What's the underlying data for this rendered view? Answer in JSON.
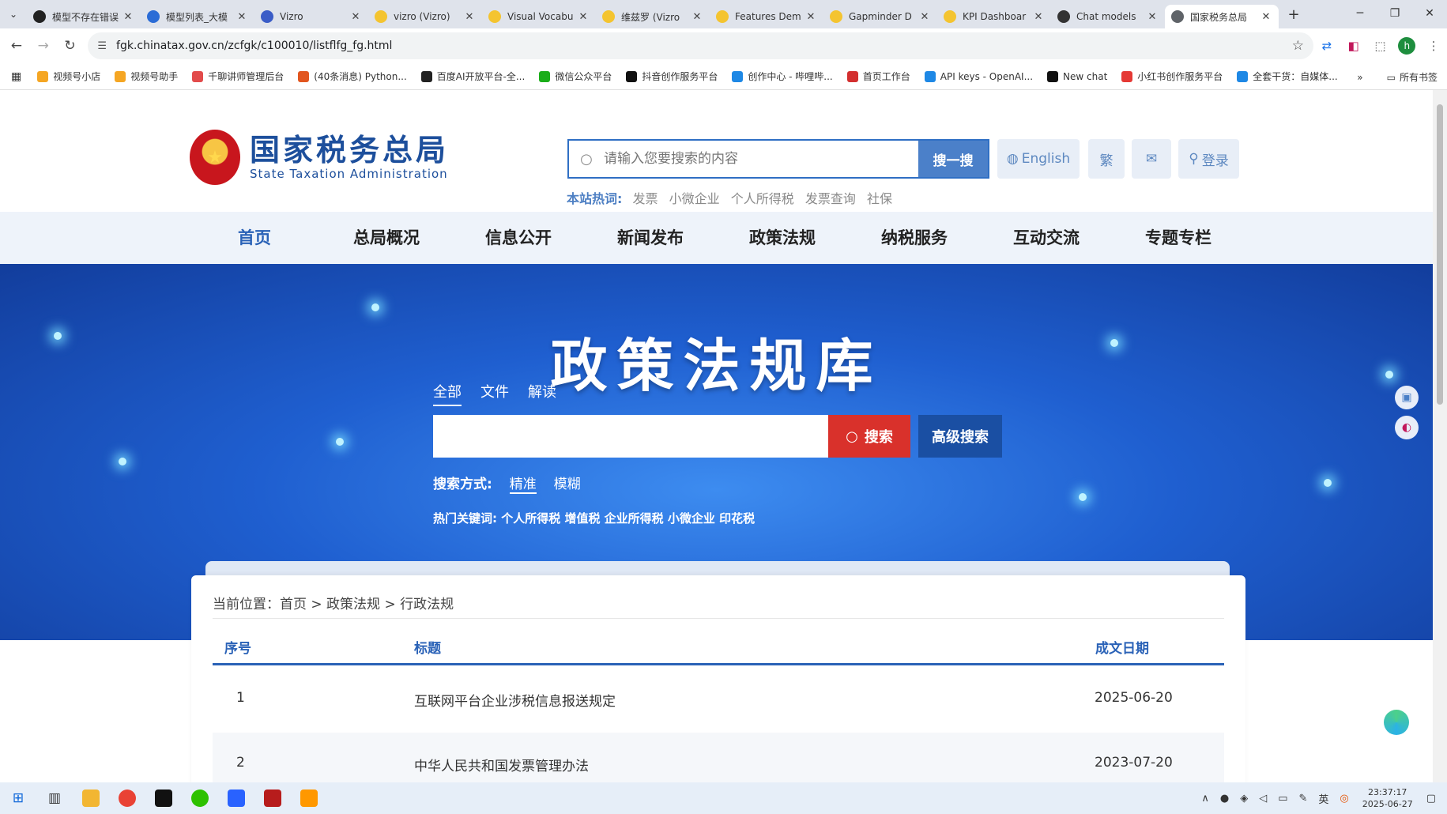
{
  "browser": {
    "tabs": [
      {
        "title": "模型不存在错误",
        "fav_color": "#222222",
        "active": false
      },
      {
        "title": "模型列表_大模",
        "fav_color": "#2b6cd6",
        "active": false
      },
      {
        "title": "Vizro",
        "fav_color": "#3a5cc7",
        "active": false
      },
      {
        "title": "vizro (Vizro)",
        "fav_color": "#f4c430",
        "active": false
      },
      {
        "title": "Visual Vocabu",
        "fav_color": "#f4c430",
        "active": false
      },
      {
        "title": "维兹罗 (Vizro",
        "fav_color": "#f4c430",
        "active": false
      },
      {
        "title": "Features Dem",
        "fav_color": "#f4c430",
        "active": false
      },
      {
        "title": "Gapminder D",
        "fav_color": "#f4c430",
        "active": false
      },
      {
        "title": "KPI Dashboar",
        "fav_color": "#f4c430",
        "active": false
      },
      {
        "title": "Chat models",
        "fav_color": "#333333",
        "active": false
      },
      {
        "title": "国家税务总局",
        "fav_color": "#5f6368",
        "active": true
      }
    ],
    "url": "fgk.chinatax.gov.cn/zcfgk/c100010/listflfg_fg.html",
    "profile_initial": "h",
    "bookmarks": [
      {
        "label": "视频号小店",
        "color": "#f5a623"
      },
      {
        "label": "视频号助手",
        "color": "#f5a623"
      },
      {
        "label": "千聊讲师管理后台",
        "color": "#e24b4b"
      },
      {
        "label": "(40条消息) Python...",
        "color": "#e2561f"
      },
      {
        "label": "百度AI开放平台-全...",
        "color": "#222222"
      },
      {
        "label": "微信公众平台",
        "color": "#1aad19"
      },
      {
        "label": "抖音创作服务平台",
        "color": "#111111"
      },
      {
        "label": "创作中心 - 哔哩哔...",
        "color": "#1e88e5"
      },
      {
        "label": "首页工作台",
        "color": "#d32f2f"
      },
      {
        "label": "API keys - OpenAI...",
        "color": "#1e88e5"
      },
      {
        "label": "New chat",
        "color": "#111111"
      },
      {
        "label": "小红书创作服务平台",
        "color": "#e53935"
      },
      {
        "label": "全套干货：自媒体...",
        "color": "#1e88e5"
      }
    ],
    "all_bookmarks_label": "所有书签"
  },
  "header": {
    "logo_cn": "国家税务总局",
    "logo_en": "State Taxation Administration",
    "search_placeholder": "请输入您要搜索的内容",
    "search_button": "搜一搜",
    "english_button": "English",
    "traditional_button": "繁",
    "login_button": "登录",
    "hot_label": "本站热词:",
    "hot_words": [
      "发票",
      "小微企业",
      "个人所得税",
      "发票查询",
      "社保"
    ]
  },
  "nav": {
    "items": [
      "首页",
      "总局概况",
      "信息公开",
      "新闻发布",
      "政策法规",
      "纳税服务",
      "互动交流",
      "专题专栏"
    ]
  },
  "banner": {
    "title": "政策法规库",
    "tabs": [
      "全部",
      "文件",
      "解读"
    ],
    "search_button": "搜索",
    "advanced_button": "高级搜索",
    "mode_label": "搜索方式:",
    "mode_options": [
      "精准",
      "模糊"
    ],
    "hot_label": "热门关键词:",
    "hot_words": "个人所得税 增值税 企业所得税 小微企业 印花税"
  },
  "content": {
    "breadcrumb": "当前位置：首页 > 政策法规 > 行政法规",
    "columns": {
      "no": "序号",
      "title": "标题",
      "date": "成文日期"
    },
    "rows": [
      {
        "no": "1",
        "title": "互联网平台企业涉税信息报送规定",
        "date": "2025-06-20"
      },
      {
        "no": "2",
        "title": "中华人民共和国发票管理办法",
        "date": "2023-07-20"
      }
    ]
  },
  "taskbar": {
    "time": "23:37:17",
    "date": "2025-06-27"
  }
}
